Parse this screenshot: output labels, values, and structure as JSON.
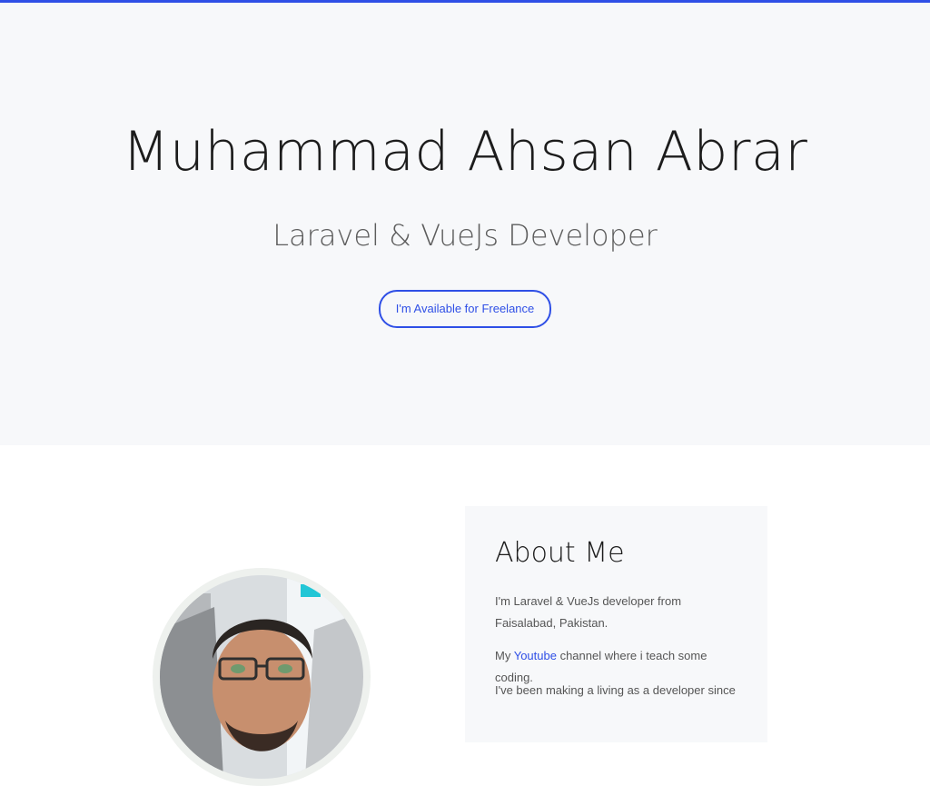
{
  "hero": {
    "name": "Muhammad Ahsan Abrar",
    "role": "Laravel & VueJs Developer",
    "cta_label": "I'm Available for Freelance"
  },
  "about": {
    "title": "About Me",
    "intro": "I'm Laravel & VueJs developer from Faisalabad, Pakistan.",
    "youtube_prefix": "My ",
    "youtube_link": "Youtube",
    "youtube_suffix": " channel where i teach some coding.",
    "career": "I've been making a living as a developer since"
  },
  "colors": {
    "accent": "#2f4fe6",
    "hero_bg": "#f7f8fa",
    "card_bg": "#f7f8fa"
  },
  "icons": {
    "avatar": "profile-photo"
  }
}
